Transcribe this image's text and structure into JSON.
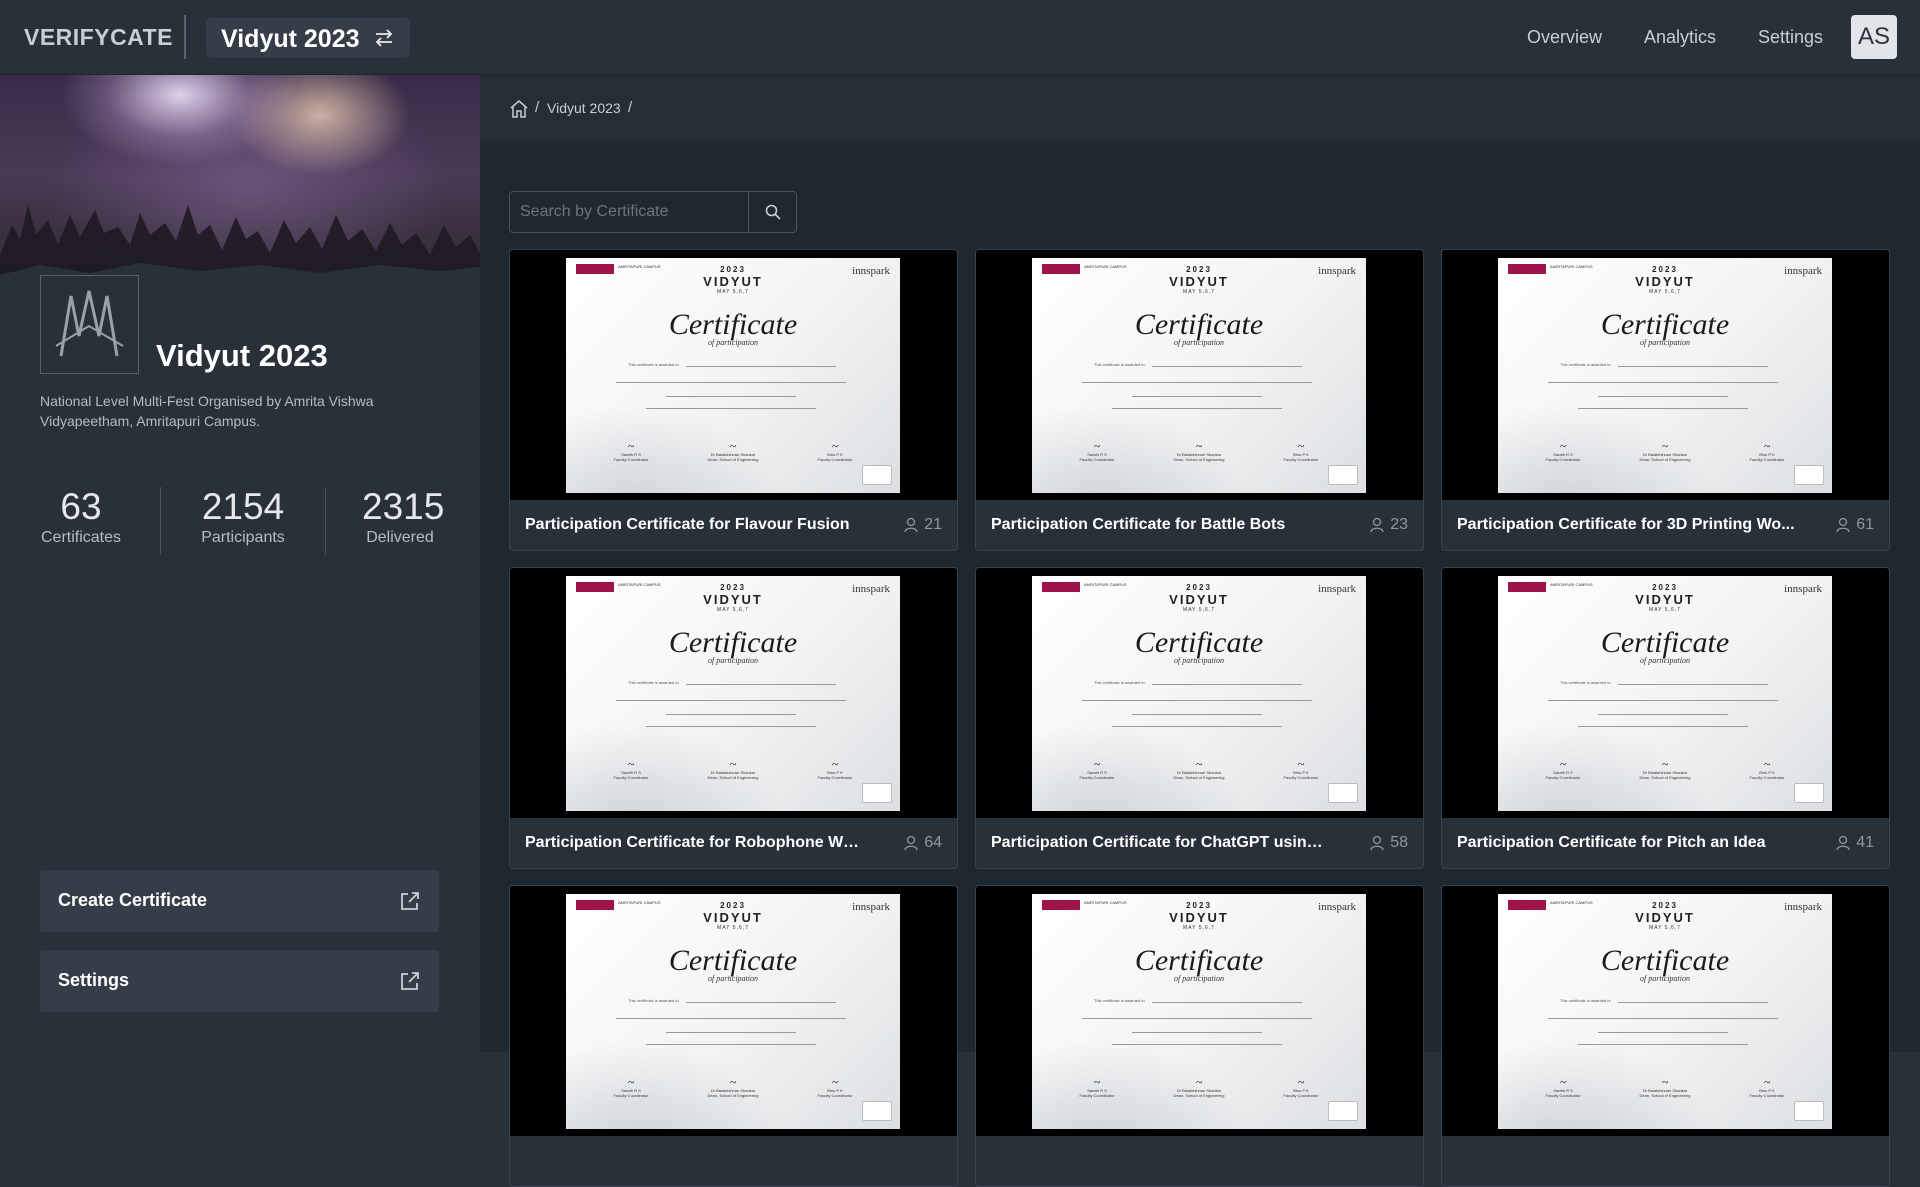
{
  "topbar": {
    "brand": "VERIFYCATE",
    "event_name": "Vidyut 2023",
    "nav": [
      "Overview",
      "Analytics",
      "Settings"
    ],
    "avatar_initials": "AS"
  },
  "sidebar": {
    "event_title": "Vidyut 2023",
    "description": "National Level Multi-Fest Organised by Amrita Vishwa Vidyapeetham, Amritapuri Campus.",
    "stats": [
      {
        "value": "63",
        "label": "Certificates"
      },
      {
        "value": "2154",
        "label": "Participants"
      },
      {
        "value": "2315",
        "label": "Delivered"
      }
    ],
    "buttons": [
      {
        "label": "Create Certificate"
      },
      {
        "label": "Settings"
      }
    ]
  },
  "breadcrumb": {
    "items": [
      "Vidyut 2023"
    ]
  },
  "search": {
    "placeholder": "Search by Certificate"
  },
  "certificate_template": {
    "brand": "AMRITA",
    "campus": "AMRITAPURI CAMPUS",
    "sponsor": "innspark",
    "year": "2023",
    "event": "VIDYUT",
    "dates": "MAY 5,6,7",
    "heading": "Certificate",
    "subheading": "of participation",
    "awarded_text": "This certificate is awarded to",
    "signatories": [
      {
        "name": "Sarath R S",
        "role": "Faculty Coordinator"
      },
      {
        "name": "Dr Balakrishnan Shankar",
        "role": "Dean, School of Engineering"
      },
      {
        "name": "Binu P K",
        "role": "Faculty Coordinator"
      }
    ]
  },
  "cards": [
    {
      "title": "Participation Certificate for Flavour Fusion",
      "count": "21"
    },
    {
      "title": "Participation Certificate for Battle Bots",
      "count": "23"
    },
    {
      "title": "Participation Certificate for 3D Printing Wo...",
      "count": "61"
    },
    {
      "title": "Participation Certificate for Robophone Wo...",
      "count": "64"
    },
    {
      "title": "Participation Certificate for ChatGPT using ...",
      "count": "58"
    },
    {
      "title": "Participation Certificate for Pitch an Idea",
      "count": "41"
    },
    {
      "title": "",
      "count": ""
    },
    {
      "title": "",
      "count": ""
    },
    {
      "title": "",
      "count": ""
    }
  ],
  "colors": {
    "background": "#1f272f",
    "panel": "#283039",
    "button": "#353e48",
    "brand_accent": "#a0134a"
  }
}
